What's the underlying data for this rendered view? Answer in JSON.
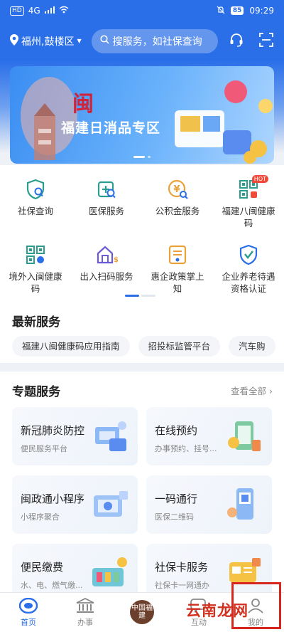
{
  "status_bar": {
    "sim": "HD",
    "network": "4G",
    "battery": "85",
    "time": "09:29"
  },
  "header": {
    "location": "福州,鼓楼区",
    "search_placeholder": "搜服务，如社保查询"
  },
  "banner": {
    "logo_text": "闽",
    "title": "福建日消品专区"
  },
  "services": [
    {
      "label": "社保查询",
      "icon": "social-security-icon"
    },
    {
      "label": "医保服务",
      "icon": "medical-insurance-icon"
    },
    {
      "label": "公积金服务",
      "icon": "housing-fund-icon"
    },
    {
      "label": "福建八闽健康码",
      "icon": "health-code-icon",
      "badge": "HOT"
    },
    {
      "label": "境外入闽健康码",
      "icon": "overseas-health-code-icon"
    },
    {
      "label": "出入扫码服务",
      "icon": "scan-entry-icon"
    },
    {
      "label": "惠企政策掌上知",
      "icon": "enterprise-policy-icon"
    },
    {
      "label": "企业养老待遇资格认证",
      "icon": "pension-cert-icon"
    }
  ],
  "latest": {
    "title": "最新服务",
    "chips": [
      "福建八闽健康码应用指南",
      "招投标监管平台",
      "汽车购"
    ]
  },
  "special": {
    "title": "专题服务",
    "see_all": "查看全部",
    "cards": [
      {
        "title": "新冠肺炎防控",
        "subtitle": "便民服务平台"
      },
      {
        "title": "在线预约",
        "subtitle": "办事预约、挂号..."
      },
      {
        "title": "闽政通小程序",
        "subtitle": "小程序聚合"
      },
      {
        "title": "一码通行",
        "subtitle": "医保二维码"
      },
      {
        "title": "便民缴费",
        "subtitle": "水、电、燃气缴..."
      },
      {
        "title": "社保卡服务",
        "subtitle": "社保卡一网通办"
      }
    ]
  },
  "tabbar": {
    "tabs": [
      {
        "label": "首页",
        "active": true
      },
      {
        "label": "办事",
        "active": false
      },
      {
        "label": "",
        "badge": "中国福建"
      },
      {
        "label": "互动",
        "active": false
      },
      {
        "label": "我的",
        "active": false
      }
    ]
  },
  "watermark": "云南龙网",
  "colors": {
    "primary": "#2a6ee8",
    "hot": "#f04b3a",
    "highlight_box": "#d7261e"
  }
}
